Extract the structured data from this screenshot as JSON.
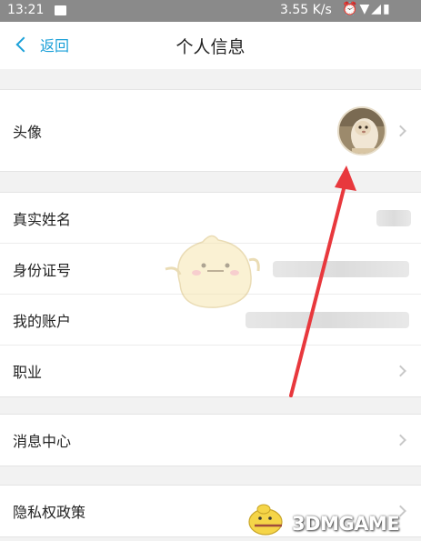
{
  "status_bar": {
    "time": "13:21",
    "net_speed": "3.55 K/s",
    "icons": [
      "image-icon",
      "alarm-icon",
      "wifi-icon",
      "signal-icon",
      "battery-icon"
    ]
  },
  "nav": {
    "back_label": "返回",
    "title": "个人信息"
  },
  "sections": {
    "avatar": {
      "label": "头像"
    },
    "identity": {
      "items": [
        {
          "label": "真实姓名"
        },
        {
          "label": "身份证号"
        },
        {
          "label": "我的账户"
        },
        {
          "label": "职业"
        }
      ]
    },
    "messages": {
      "label": "消息中心"
    },
    "privacy": {
      "label": "隐私权政策"
    }
  },
  "watermark": {
    "text": "3DMGAME"
  },
  "colors": {
    "accent": "#1aa0d8",
    "annotation_arrow": "#e8383d",
    "background": "#f2f2f2"
  }
}
